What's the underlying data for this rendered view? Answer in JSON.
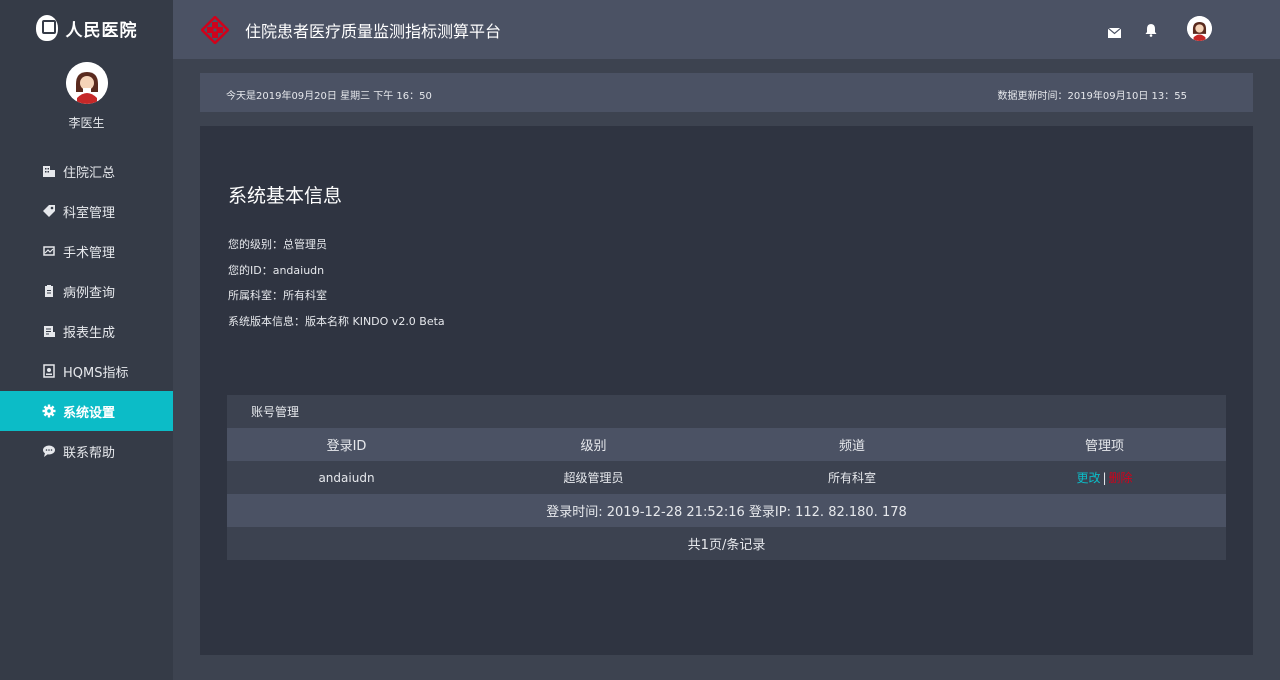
{
  "brand": {
    "name": "人民医院"
  },
  "profile": {
    "name": "李医生"
  },
  "nav": {
    "items": [
      {
        "label": "住院汇总",
        "icon": "building-icon"
      },
      {
        "label": "科室管理",
        "icon": "tag-icon"
      },
      {
        "label": "手术管理",
        "icon": "surgery-icon"
      },
      {
        "label": "病例查询",
        "icon": "clipboard-icon"
      },
      {
        "label": "报表生成",
        "icon": "report-icon"
      },
      {
        "label": "HQMS指标",
        "icon": "badge-icon"
      },
      {
        "label": "系统设置",
        "icon": "gear-icon",
        "active": true
      },
      {
        "label": "联系帮助",
        "icon": "chat-icon"
      }
    ]
  },
  "header": {
    "title": "住院患者医疗质量监测指标测算平台"
  },
  "infobar": {
    "today": "今天是2019年09月20日  星期三  下午 16：50",
    "updated": "数据更新时间：2019年09月10日   13：55"
  },
  "system": {
    "title": "系统基本信息",
    "level": "您的级别：总管理员",
    "id": "您的ID：andaiudn",
    "dept": "所属科室：所有科室",
    "version": "系统版本信息：版本名称 KINDO v2.0 Beta"
  },
  "account": {
    "title": "账号管理",
    "columns": [
      "登录ID",
      "级别",
      "频道",
      "管理项"
    ],
    "row": {
      "id": "andaiudn",
      "level": "超级管理员",
      "channel": "所有科室",
      "edit": "更改",
      "sep": "|",
      "delete": "删除"
    },
    "login": "登录时间: 2019-12-28 21:52:16   登录IP: 112. 82.180. 178",
    "pager": "共1页/条记录"
  },
  "colors": {
    "accent": "#0cbcc7",
    "danger": "#d0021b",
    "sidebar": "#353b47",
    "header": "#4b5264"
  }
}
